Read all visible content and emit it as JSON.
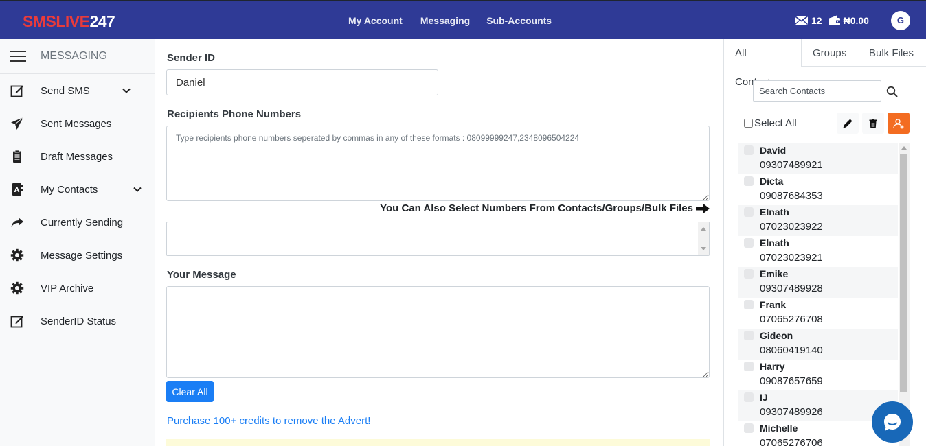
{
  "brand": {
    "part1": "SMSLIVE",
    "part2": "247"
  },
  "topnav": [
    {
      "label": "My Account",
      "active": false
    },
    {
      "label": "Messaging",
      "active": true
    },
    {
      "label": "Sub-Accounts",
      "active": false
    }
  ],
  "account": {
    "messages_count": "12",
    "balance": "₦0.00",
    "avatar_initial": "G"
  },
  "sidebar": {
    "title": "MESSAGING",
    "items": [
      {
        "label": "Send SMS",
        "icon": "edit-icon",
        "has_chevron": true
      },
      {
        "label": "Sent Messages",
        "icon": "paper-plane-icon",
        "has_chevron": false
      },
      {
        "label": "Draft Messages",
        "icon": "clipboard-icon",
        "has_chevron": false
      },
      {
        "label": "My Contacts",
        "icon": "address-book-icon",
        "has_chevron": true
      },
      {
        "label": "Currently Sending",
        "icon": "share-arrow-icon",
        "has_chevron": false
      },
      {
        "label": "Message Settings",
        "icon": "gear-icon",
        "has_chevron": false
      },
      {
        "label": "VIP Archive",
        "icon": "gear-icon",
        "has_chevron": false
      },
      {
        "label": "SenderID Status",
        "icon": "edit-icon",
        "has_chevron": false
      }
    ]
  },
  "form": {
    "sender_label": "Sender ID",
    "sender_value": "Daniel",
    "recipients_label": "Recipients Phone Numbers",
    "recipients_placeholder": "Type recipients phone numbers seperated by commas in any of these formats : 08099999247,2348096504224",
    "contacts_hint": "You Can Also Select Numbers From Contacts/Groups/Bulk Files",
    "message_label": "Your Message",
    "clear_label": "Clear All",
    "purchase_link": "Purchase 100+ credits to remove the Advert!"
  },
  "contacts_panel": {
    "tabs": [
      {
        "label": "All Contacts",
        "active": true
      },
      {
        "label": "Groups",
        "active": false
      },
      {
        "label": "Bulk Files",
        "active": false
      }
    ],
    "search_placeholder": "Search Contacts",
    "select_all_label": "Select All",
    "contacts": [
      {
        "name": "David",
        "phone": "09307489921"
      },
      {
        "name": "Dicta",
        "phone": "09087684353"
      },
      {
        "name": "Elnath",
        "phone": "07023023922"
      },
      {
        "name": "Elnath",
        "phone": "07023023921"
      },
      {
        "name": "Emike",
        "phone": "09307489928"
      },
      {
        "name": "Frank",
        "phone": "07065276708"
      },
      {
        "name": "Gideon",
        "phone": "08060419140"
      },
      {
        "name": "Harry",
        "phone": "09087657659"
      },
      {
        "name": "IJ",
        "phone": "09307489926"
      },
      {
        "name": "Michelle",
        "phone": "07065276706"
      }
    ]
  },
  "colors": {
    "header_bg": "#2f3a96",
    "accent": "#f36c21",
    "brand_red": "#ea3b3b",
    "primary": "#1a7ef5",
    "chat": "#1868b8"
  }
}
